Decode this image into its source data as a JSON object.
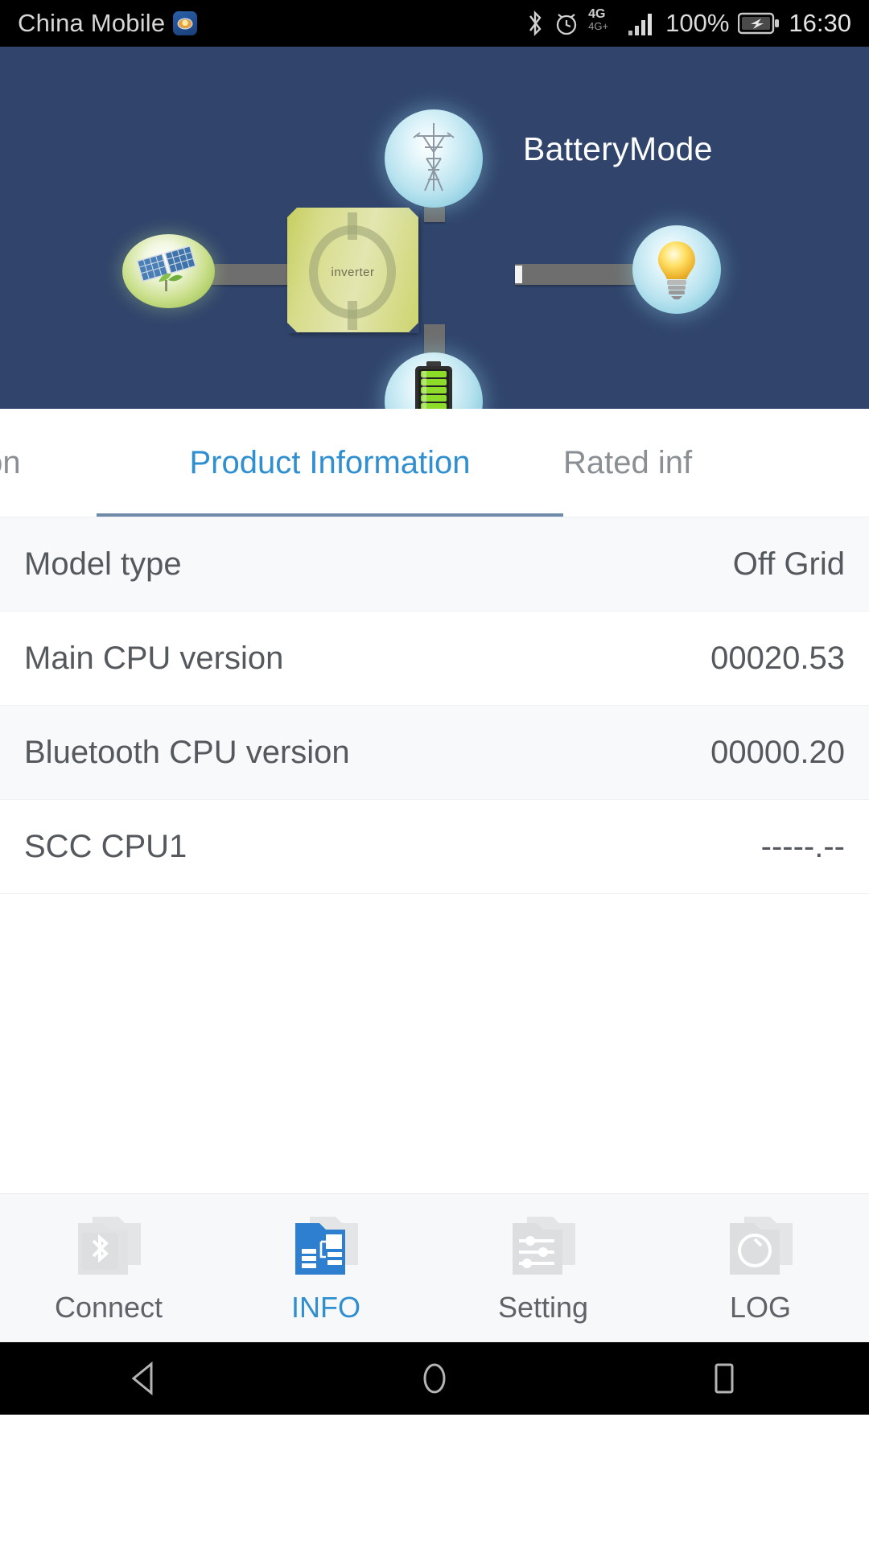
{
  "statusbar": {
    "carrier": "China Mobile",
    "carrier_icon": "eye-icon",
    "bluetooth_icon": "bluetooth-icon",
    "alarm_icon": "alarm-clock-icon",
    "network_type": "4G",
    "network_type_sub": "4G+",
    "signal_icon": "signal-bars-icon",
    "battery_percent": "100%",
    "battery_icon": "battery-charging-icon",
    "time": "16:30"
  },
  "diagram": {
    "mode_title": "BatteryMode",
    "inverter_label": "inverter",
    "nodes": {
      "grid": "power-tower-icon",
      "pv": "solar-panel-icon",
      "load": "light-bulb-icon",
      "battery": "battery-icon"
    },
    "colors": {
      "background": "#31456c",
      "inverter": "#cdd46e",
      "bar": "#6e6e6e"
    }
  },
  "tabs": {
    "items": [
      {
        "label": "ormation",
        "active": false
      },
      {
        "label": "Product Information",
        "active": true
      },
      {
        "label": "Rated inf",
        "active": false
      }
    ],
    "active_color": "#2f8fd0",
    "inactive_color": "#8a8f94"
  },
  "list": {
    "rows": [
      {
        "label": "Model type",
        "value": "Off Grid"
      },
      {
        "label": "Main CPU version",
        "value": "00020.53"
      },
      {
        "label": "Bluetooth CPU version",
        "value": "00000.20"
      },
      {
        "label": "SCC CPU1",
        "value": "-----.--"
      }
    ]
  },
  "bottomnav": {
    "items": [
      {
        "label": "Connect",
        "icon": "bluetooth-folder-icon",
        "active": false
      },
      {
        "label": "INFO",
        "icon": "info-folder-icon",
        "active": true
      },
      {
        "label": "Setting",
        "icon": "sliders-folder-icon",
        "active": false
      },
      {
        "label": "LOG",
        "icon": "power-folder-icon",
        "active": false
      }
    ],
    "active_color": "#2f8fd0"
  },
  "androidnav": {
    "back": "back-triangle-icon",
    "home": "home-circle-icon",
    "recents": "recents-square-icon"
  }
}
